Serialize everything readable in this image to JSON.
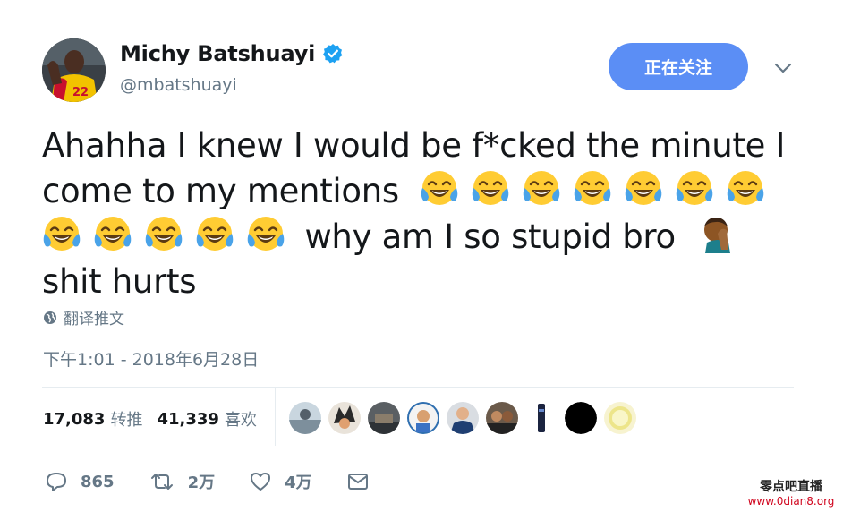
{
  "tweet": {
    "display_name": "Michy Batshuayi",
    "handle": "@mbatshuayi",
    "follow_label": "正在关注",
    "text": {
      "line1": "Ahahha I knew I would be f*cked the minute I",
      "line2": "come to my mentions",
      "line3": "why am I so stupid bro",
      "line4": "shit hurts"
    },
    "translate_label": "翻译推文",
    "timestamp": "下午1:01 - 2018年6月28日",
    "retweets_count": "17,083",
    "retweets_label": "转推",
    "likes_count": "41,339",
    "likes_label": "喜欢",
    "actions": {
      "reply_count": "865",
      "retweet_count": "2万",
      "like_count": "4万"
    }
  },
  "watermark": {
    "line1": "零点吧直播",
    "line2": "www.0dian8.org"
  },
  "colors": {
    "accent": "#5b8ef5",
    "verified": "#1da1f2",
    "muted": "#657786",
    "emoji_face": "#ffcc33",
    "emoji_tear": "#4aa3e8"
  }
}
